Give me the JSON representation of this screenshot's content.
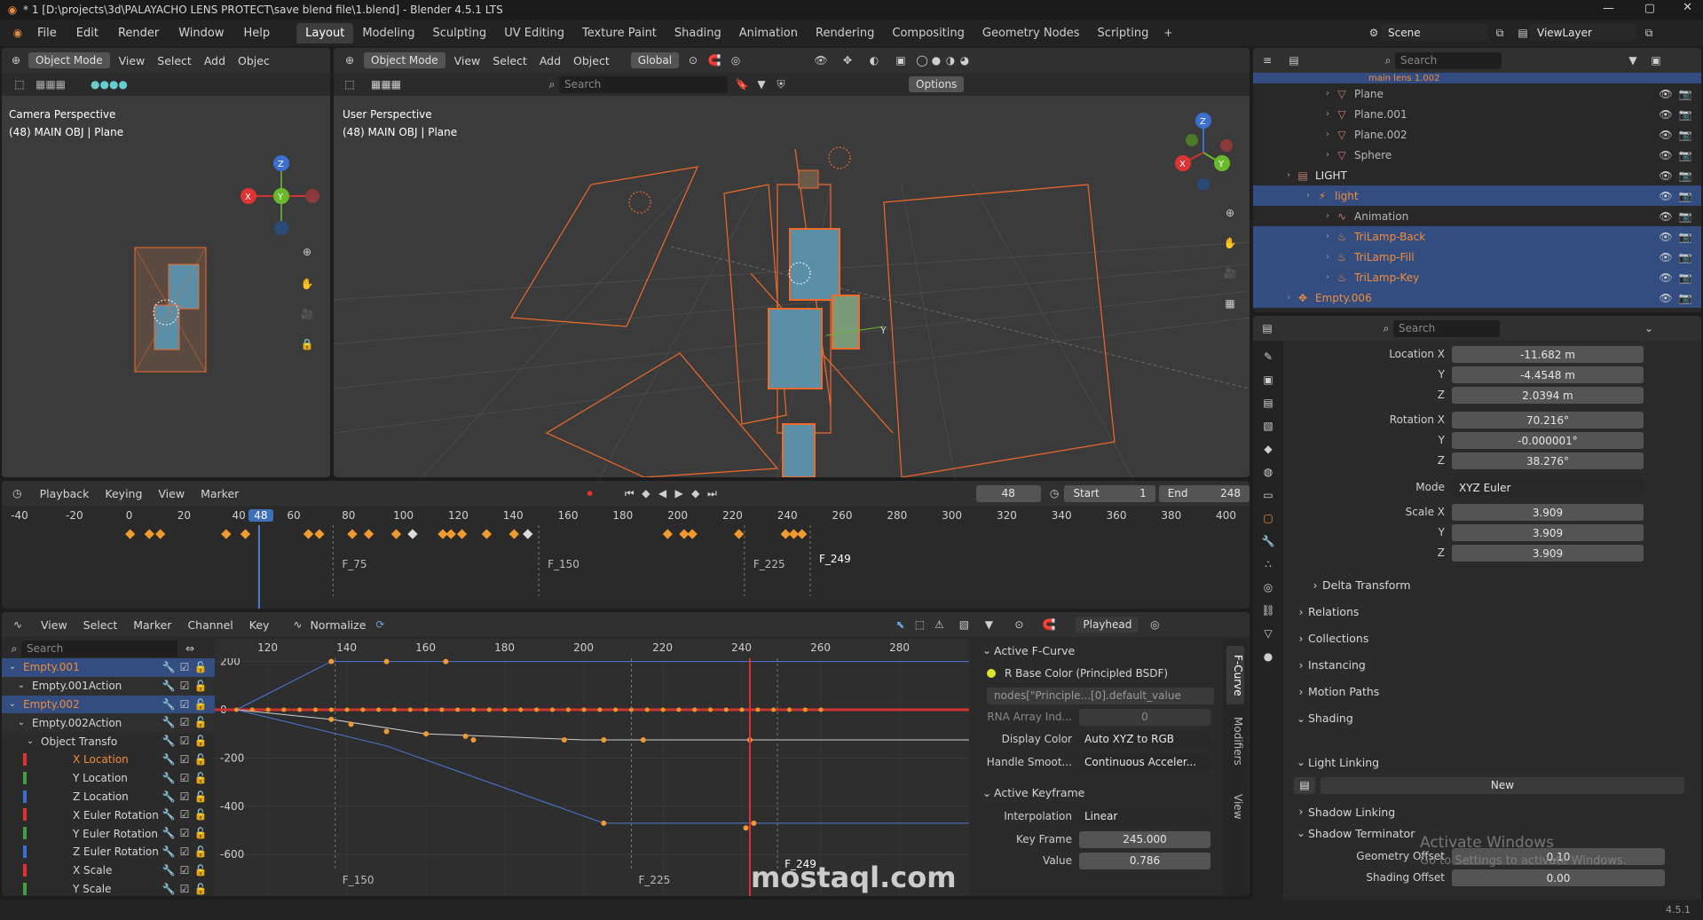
{
  "window": {
    "title": "* 1 [D:\\projects\\3d\\PALAYACHO LENS PROTECT\\save blend file\\1.blend] - Blender 4.5.1 LTS"
  },
  "menu": [
    "File",
    "Edit",
    "Render",
    "Window",
    "Help"
  ],
  "workspaces": [
    "Layout",
    "Modeling",
    "Sculpting",
    "UV Editing",
    "Texture Paint",
    "Shading",
    "Animation",
    "Rendering",
    "Compositing",
    "Geometry Nodes",
    "Scripting"
  ],
  "scene": "Scene",
  "viewlayer": "ViewLayer",
  "vp_left": {
    "mode": "Object Mode",
    "menus": [
      "View",
      "Select",
      "Add",
      "Objec"
    ],
    "title": "Camera Perspective",
    "sub": "(48) MAIN OBJ | Plane"
  },
  "vp_main": {
    "mode": "Object Mode",
    "menus": [
      "View",
      "Select",
      "Add",
      "Object"
    ],
    "orient": "Global",
    "search": "Search",
    "options": "Options",
    "title": "User Perspective",
    "sub": "(48) MAIN OBJ | Plane",
    "axis_y": "Y"
  },
  "outliner": {
    "search": "Search",
    "top_item": "main lens 1.002",
    "items": [
      {
        "label": "Plane"
      },
      {
        "label": "Plane.001"
      },
      {
        "label": "Plane.002"
      },
      {
        "label": "Sphere"
      },
      {
        "label": "LIGHT"
      },
      {
        "label": "light"
      },
      {
        "label": "Animation"
      },
      {
        "label": "TriLamp-Back"
      },
      {
        "label": "TriLamp-Fill"
      },
      {
        "label": "TriLamp-Key"
      },
      {
        "label": "Empty.006"
      }
    ]
  },
  "props": {
    "search": "Search",
    "loc_label": "Location X",
    "loc": [
      "-11.682 m",
      "-4.4548 m",
      "2.0394 m"
    ],
    "rot_label": "Rotation X",
    "rot": [
      "70.216°",
      "-0.000001°",
      "38.276°"
    ],
    "mode_label": "Mode",
    "mode": "XYZ Euler",
    "scale_label": "Scale X",
    "scale": [
      "3.909",
      "3.909",
      "3.909"
    ],
    "axes": [
      "Y",
      "Z"
    ],
    "sections": [
      "Delta Transform",
      "Relations",
      "Collections",
      "Instancing",
      "Motion Paths",
      "Shading"
    ],
    "light_linking": "Light Linking",
    "new": "New",
    "shadow_linking": "Shadow Linking",
    "shadow_term": "Shadow Terminator",
    "geo_offset_label": "Geometry Offset",
    "geo_offset": "0.10",
    "shade_offset_label": "Shading Offset",
    "shade_offset": "0.00"
  },
  "timeline": {
    "menus": [
      "Playback",
      "Keying",
      "View",
      "Marker"
    ],
    "frame": "48",
    "start_label": "Start",
    "start": "1",
    "end_label": "End",
    "end": "248",
    "ticks": [
      "-40",
      "-20",
      "0",
      "20",
      "40",
      "48",
      "60",
      "80",
      "100",
      "120",
      "140",
      "160",
      "180",
      "200",
      "220",
      "240",
      "260",
      "280",
      "300",
      "320",
      "340",
      "360",
      "380",
      "400"
    ],
    "markers": [
      "F_75",
      "F_150",
      "F_225",
      "F_249"
    ]
  },
  "graph": {
    "menus": [
      "View",
      "Select",
      "Marker",
      "Channel",
      "Key"
    ],
    "normalize": "Normalize",
    "playhead": "Playhead",
    "search": "Search",
    "ticks_x": [
      "120",
      "140",
      "160",
      "180",
      "200",
      "220",
      "240",
      "260",
      "280"
    ],
    "ticks_y": [
      "200",
      "0",
      "-200",
      "-400",
      "-600"
    ],
    "markers": [
      "F_150",
      "F_225",
      "F_249"
    ],
    "channels": [
      "Empty.001",
      "Empty.001Action",
      "Empty.002",
      "Empty.002Action",
      "Object Transfo",
      "X Location",
      "Y Location",
      "Z Location",
      "X Euler Rotation",
      "Y Euler Rotation",
      "Z Euler Rotation",
      "X Scale",
      "Y Scale"
    ]
  },
  "fcurve": {
    "active": "Active F-Curve",
    "name": "R Base Color (Principled BSDF)",
    "path": "nodes[\"Principle...[0].default_value",
    "rna_label": "RNA Array Ind...",
    "rna": "0",
    "display_label": "Display Color",
    "display": "Auto XYZ to RGB",
    "handle_label": "Handle Smoot...",
    "handle": "Continuous Acceler...",
    "active_key": "Active Keyframe",
    "interp_label": "Interpolation",
    "interp": "Linear",
    "keyframe_label": "Key Frame",
    "keyframe": "245.000",
    "value_label": "Value",
    "value": "0.786",
    "tabs": [
      "F-Curve",
      "Modifiers",
      "View"
    ]
  },
  "watermark": {
    "activate": "Activate Windows",
    "goto": "Go to Settings to activate Windows.",
    "site": "mostaql.com"
  },
  "version": "4.5.1"
}
